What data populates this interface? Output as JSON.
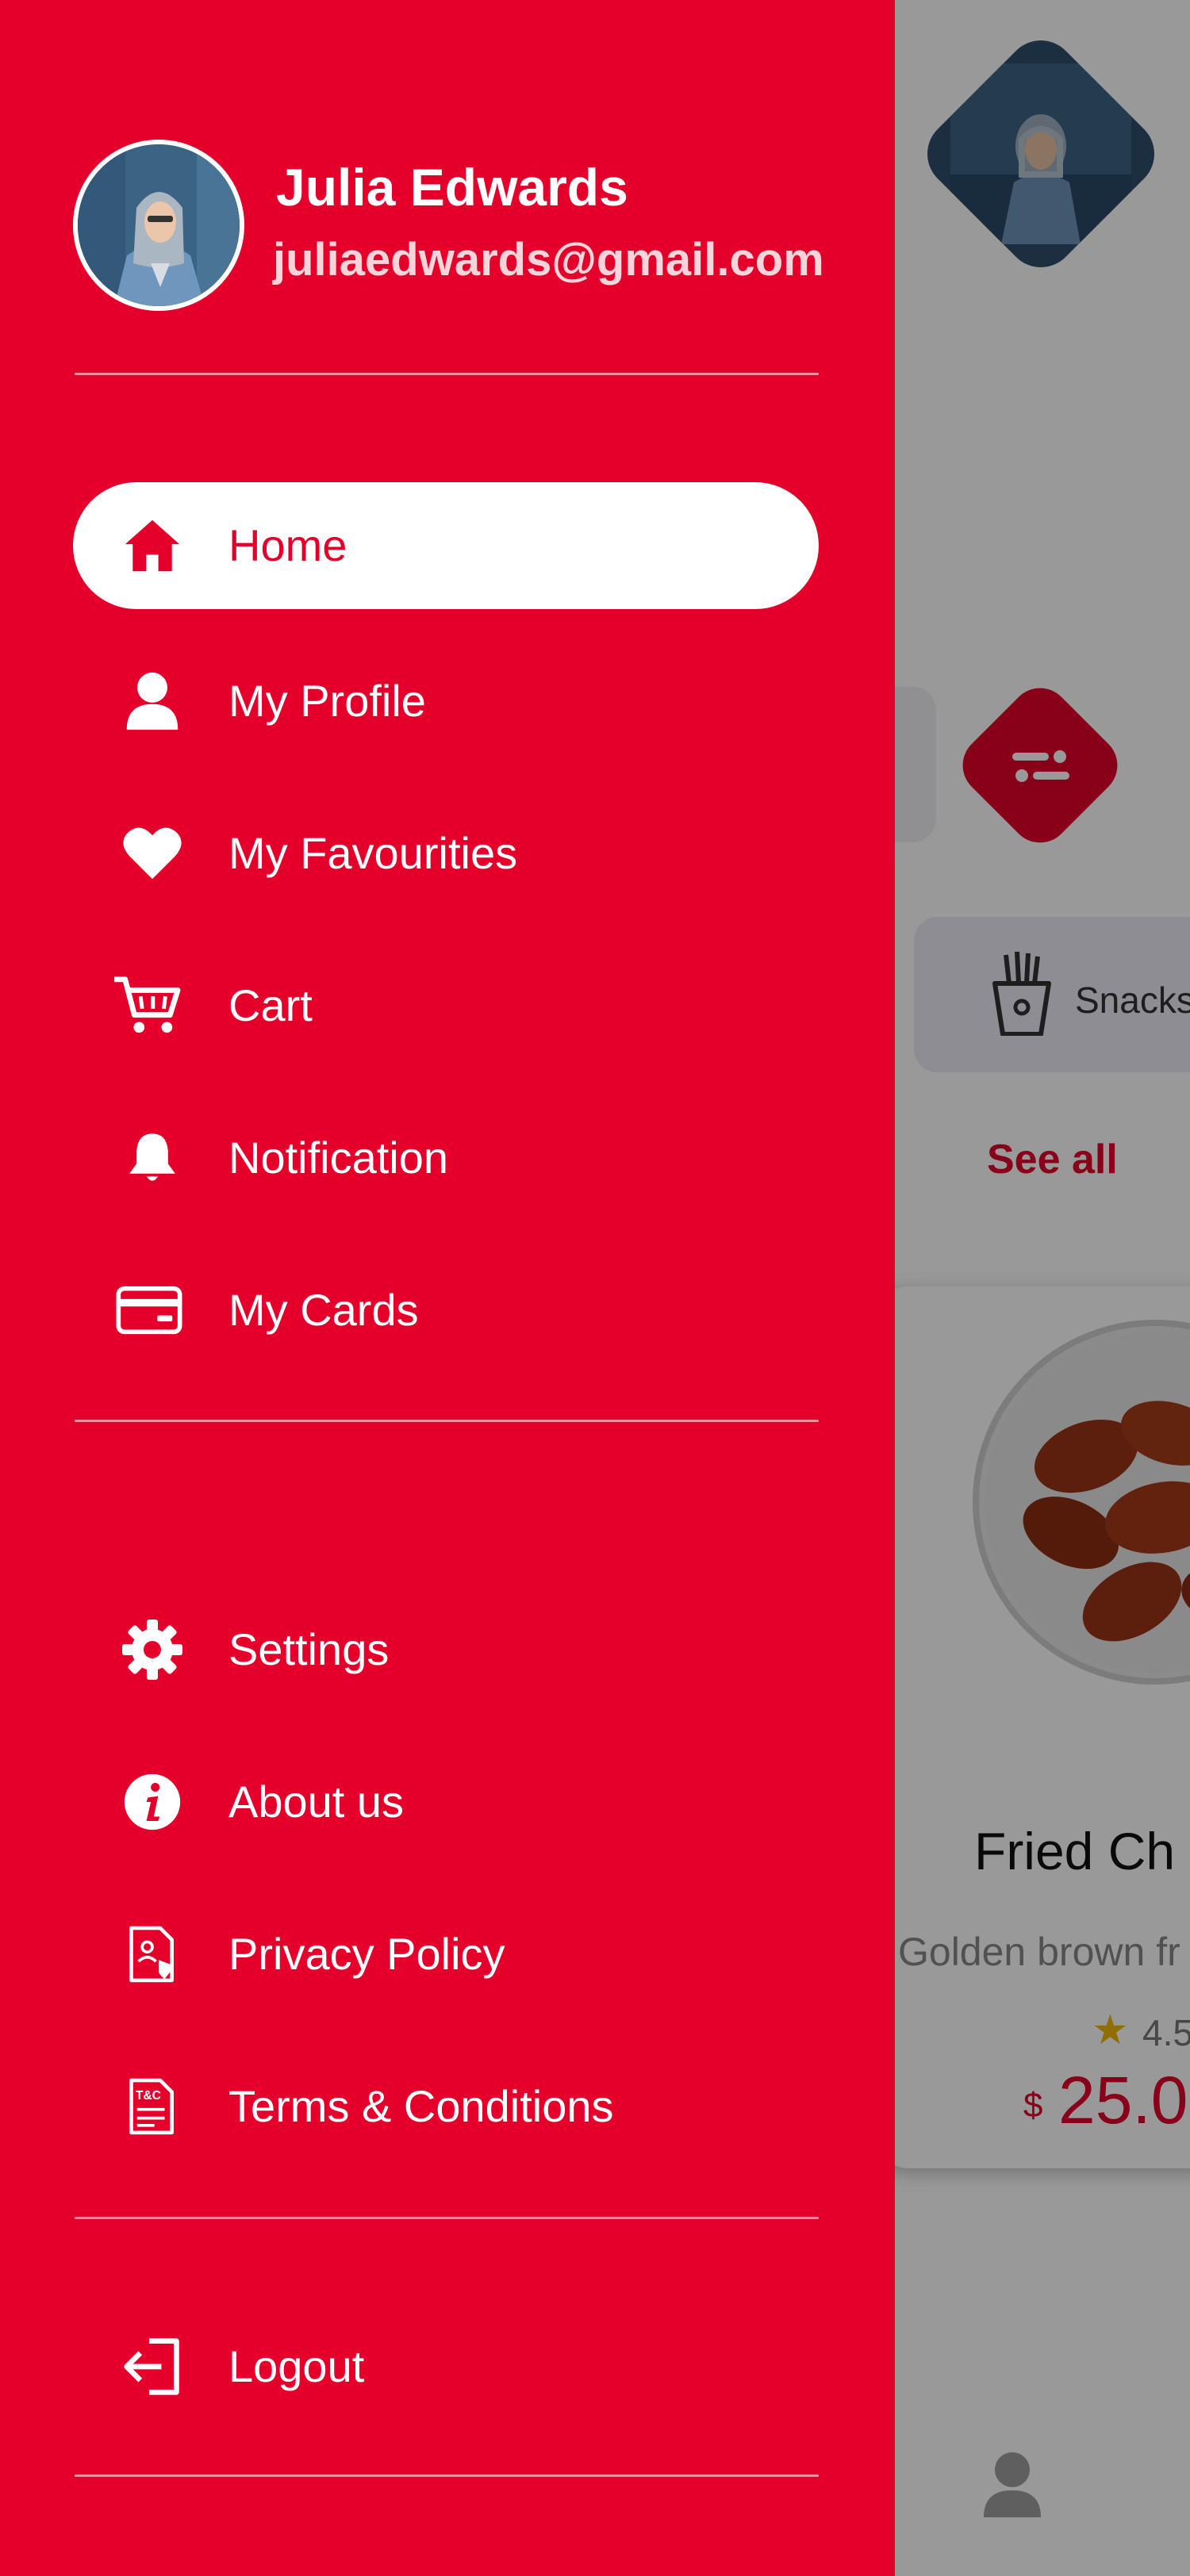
{
  "colors": {
    "primary": "#e4002b",
    "white": "#ffffff",
    "star": "#f2b705"
  },
  "drawer": {
    "user": {
      "name": "Julia Edwards",
      "email": "juliaedwards@gmail.com"
    },
    "menu": [
      {
        "label": "Home",
        "icon": "home-icon",
        "active": true
      },
      {
        "label": "My Profile",
        "icon": "user-icon",
        "active": false
      },
      {
        "label": "My Favourities",
        "icon": "heart-icon",
        "active": false
      },
      {
        "label": "Cart",
        "icon": "cart-icon",
        "active": false
      },
      {
        "label": "Notification",
        "icon": "bell-icon",
        "active": false
      },
      {
        "label": "My Cards",
        "icon": "credit-card-icon",
        "active": false
      }
    ],
    "secondary_menu": [
      {
        "label": "Settings",
        "icon": "gear-icon"
      },
      {
        "label": "About us",
        "icon": "info-icon"
      },
      {
        "label": "Privacy Policy",
        "icon": "privacy-document-icon"
      },
      {
        "label": "Terms & Conditions",
        "icon": "terms-document-icon",
        "icon_text": "T&C"
      }
    ],
    "logout": {
      "label": "Logout",
      "icon": "logout-icon"
    }
  },
  "background": {
    "category_chip": {
      "label": "Snacks",
      "icon": "fries-icon"
    },
    "see_all": "See all",
    "food_card": {
      "title": "Fried Ch",
      "description": "Golden brown fr",
      "rating": "4.5",
      "currency": "$",
      "price": "25.0"
    }
  }
}
